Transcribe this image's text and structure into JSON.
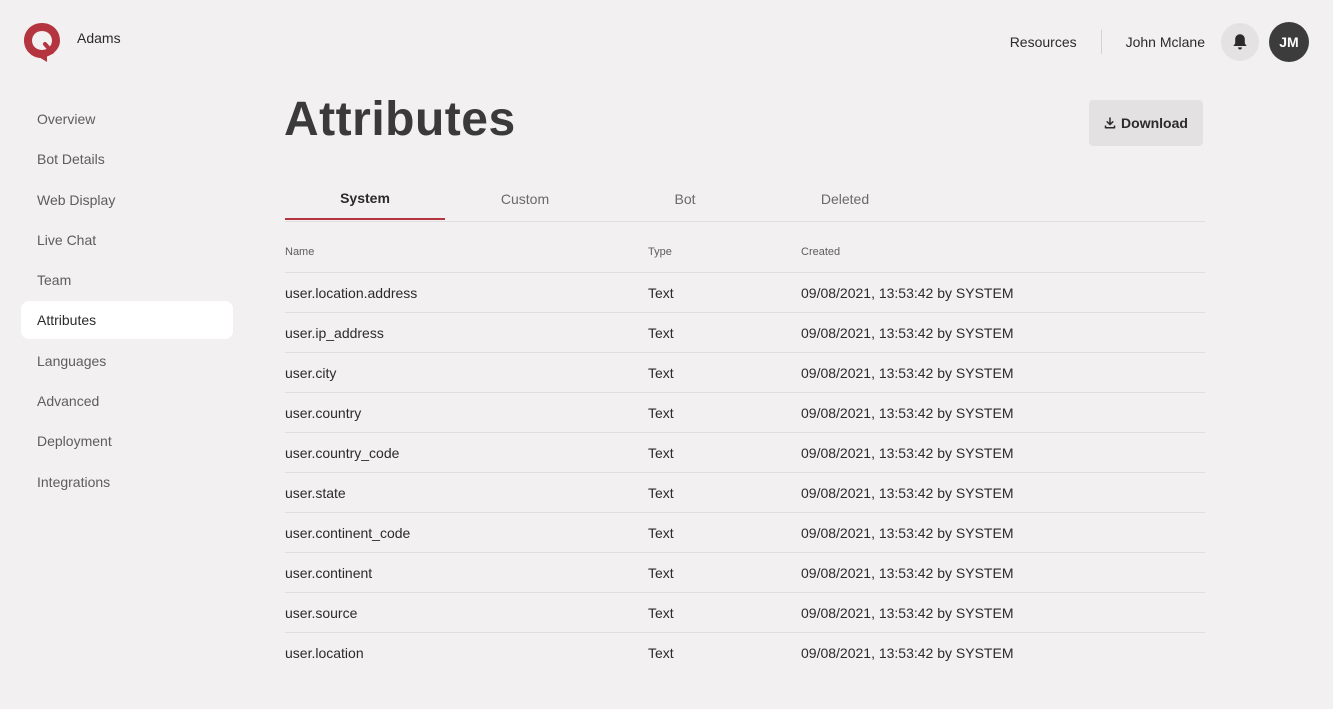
{
  "header": {
    "bot_name": "Adams",
    "resources_label": "Resources",
    "user_name": "John Mclane",
    "avatar_initials": "JM",
    "logo_icon": "chat-bubble-logo-icon",
    "bell_icon": "bell-icon"
  },
  "sidebar": {
    "items": [
      {
        "label": "Overview",
        "active": false
      },
      {
        "label": "Bot Details",
        "active": false
      },
      {
        "label": "Web Display",
        "active": false
      },
      {
        "label": "Live Chat",
        "active": false
      },
      {
        "label": "Team",
        "active": false
      },
      {
        "label": "Attributes",
        "active": true
      },
      {
        "label": "Languages",
        "active": false
      },
      {
        "label": "Advanced",
        "active": false
      },
      {
        "label": "Deployment",
        "active": false
      },
      {
        "label": "Integrations",
        "active": false
      }
    ]
  },
  "main": {
    "title": "Attributes",
    "download_label": "Download",
    "download_icon": "download-icon",
    "tabs": [
      {
        "label": "System",
        "active": true
      },
      {
        "label": "Custom",
        "active": false
      },
      {
        "label": "Bot",
        "active": false
      },
      {
        "label": "Deleted",
        "active": false
      }
    ],
    "table": {
      "columns": {
        "name": "Name",
        "type": "Type",
        "created": "Created"
      },
      "rows": [
        {
          "name": "user.location.address",
          "type": "Text",
          "created": "09/08/2021, 13:53:42 by SYSTEM"
        },
        {
          "name": "user.ip_address",
          "type": "Text",
          "created": "09/08/2021, 13:53:42 by SYSTEM"
        },
        {
          "name": "user.city",
          "type": "Text",
          "created": "09/08/2021, 13:53:42 by SYSTEM"
        },
        {
          "name": "user.country",
          "type": "Text",
          "created": "09/08/2021, 13:53:42 by SYSTEM"
        },
        {
          "name": "user.country_code",
          "type": "Text",
          "created": "09/08/2021, 13:53:42 by SYSTEM"
        },
        {
          "name": "user.state",
          "type": "Text",
          "created": "09/08/2021, 13:53:42 by SYSTEM"
        },
        {
          "name": "user.continent_code",
          "type": "Text",
          "created": "09/08/2021, 13:53:42 by SYSTEM"
        },
        {
          "name": "user.continent",
          "type": "Text",
          "created": "09/08/2021, 13:53:42 by SYSTEM"
        },
        {
          "name": "user.source",
          "type": "Text",
          "created": "09/08/2021, 13:53:42 by SYSTEM"
        },
        {
          "name": "user.location",
          "type": "Text",
          "created": "09/08/2021, 13:53:42 by SYSTEM"
        }
      ]
    }
  },
  "colors": {
    "background": "#f2f0f1",
    "brand_red": "#b4343f",
    "active_item_bg": "#ffffff",
    "avatar_bg": "#3c3c3c"
  }
}
